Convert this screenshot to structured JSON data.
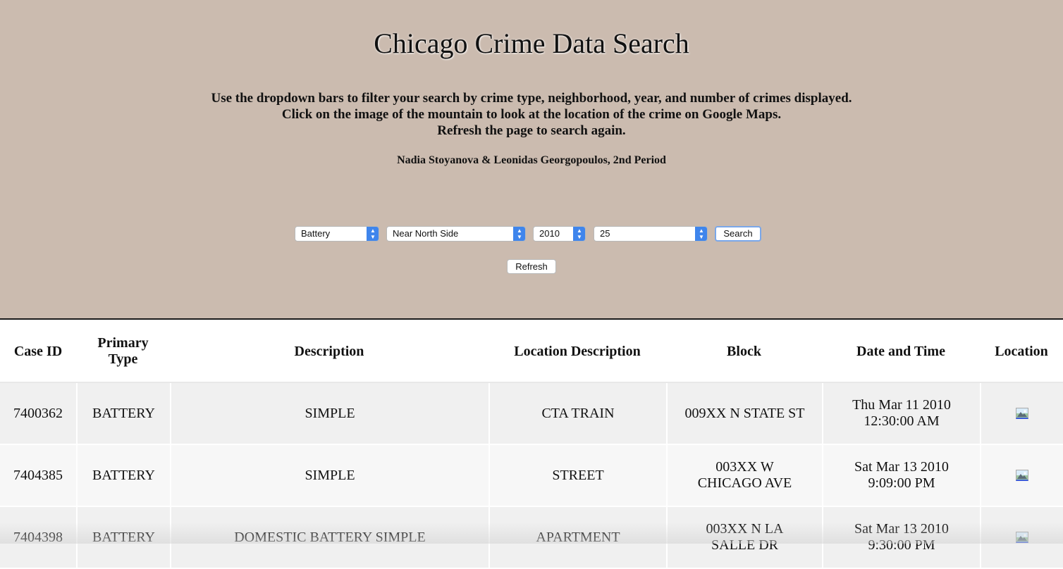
{
  "page": {
    "title": "Chicago Crime Data Search",
    "instructions": [
      "Use the dropdown bars to filter your search by crime type, neighborhood, year, and number of crimes displayed.",
      "Click on the image of the mountain to look at the location of the crime on Google Maps.",
      "Refresh the page to search again."
    ],
    "credits": "Nadia Stoyanova & Leonidas Georgopoulos, 2nd Period"
  },
  "filters": {
    "crime_type": "Battery",
    "neighborhood": "Near North Side",
    "year": "2010",
    "count": "25",
    "search_label": "Search",
    "refresh_label": "Refresh"
  },
  "colors": {
    "header_bg": "#cbbbaf",
    "select_arrow": "#3f85ec",
    "row_bg": "#f0f0f0"
  },
  "table": {
    "headers": [
      "Case ID",
      "Primary Type",
      "Description",
      "Location Description",
      "Block",
      "Date and Time",
      "Location"
    ],
    "rows": [
      {
        "case_id": "7400362",
        "primary_type": "BATTERY",
        "description": "SIMPLE",
        "location_description": "CTA TRAIN",
        "block": "009XX N STATE ST",
        "date_time": "Thu Mar 11 2010 12:30:00 AM",
        "location_icon": "mountain-image-icon"
      },
      {
        "case_id": "7404385",
        "primary_type": "BATTERY",
        "description": "SIMPLE",
        "location_description": "STREET",
        "block": "003XX W CHICAGO AVE",
        "date_time": "Sat Mar 13 2010 9:09:00 PM",
        "location_icon": "mountain-image-icon"
      },
      {
        "case_id": "7404398",
        "primary_type": "BATTERY",
        "description": "DOMESTIC BATTERY SIMPLE",
        "location_description": "APARTMENT",
        "block": "003XX N LA SALLE DR",
        "date_time": "Sat Mar 13 2010 9:30:00 PM",
        "location_icon": "mountain-image-icon"
      }
    ]
  }
}
